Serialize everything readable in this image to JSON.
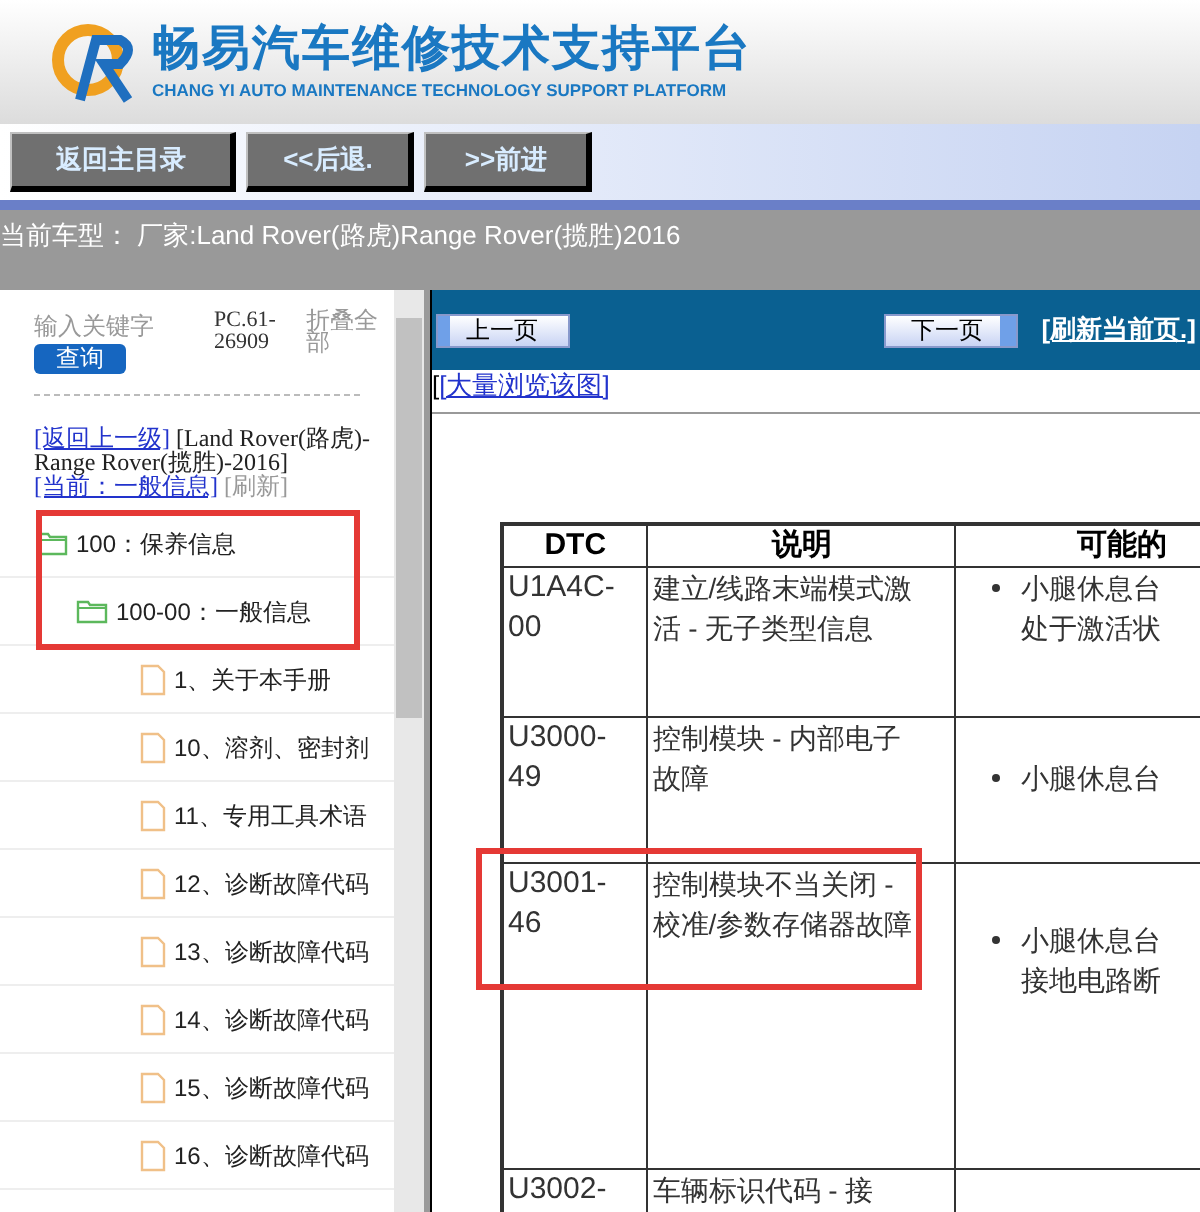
{
  "header": {
    "title": "畅易汽车维修技术支持平台",
    "subtitle": "CHANG YI AUTO MAINTENANCE TECHNOLOGY SUPPORT PLATFORM"
  },
  "nav_buttons": [
    "返回主目录",
    "<<后退.",
    ">>前进"
  ],
  "current_vehicle": "当前车型： 厂家:Land Rover(路虎)Range Rover(揽胜)2016",
  "sidebar": {
    "search": {
      "placeholder": "输入关键字",
      "button": "查询"
    },
    "code": "PC.61-26909",
    "collapse_all": "折叠全部",
    "back_link": "[返回上一级]",
    "vehicle_path": "[Land Rover(路虎)-Range Rover(揽胜)-2016]",
    "current_link": "[当前：一般信息]",
    "refresh": "[刷新]",
    "tree": [
      {
        "label": "100：保养信息",
        "expanded": true,
        "children": [
          {
            "label": "100-00：一般信息",
            "expanded": true,
            "children": [
              {
                "label": "1、关于本手册"
              },
              {
                "label": "10、溶剂、密封剂"
              },
              {
                "label": "11、专用工具术语"
              },
              {
                "label": "12、诊断故障代码"
              },
              {
                "label": "13、诊断故障代码"
              },
              {
                "label": "14、诊断故障代码"
              },
              {
                "label": "15、诊断故障代码"
              },
              {
                "label": "16、诊断故障代码"
              }
            ]
          }
        ]
      }
    ]
  },
  "toolbar": {
    "prev": "上一页",
    "next": "下一页",
    "refresh": "[刷新当前页.]"
  },
  "view_prefix": "[",
  "view_link": "[大量浏览该图]",
  "table": {
    "columns": [
      "DTC",
      "说明",
      "可能的"
    ],
    "rows": [
      {
        "cells": [
          "U1A4C-00",
          "建立/线路末端模式激活 - 无子类型信息",
          "小腿休息台处于激活状"
        ],
        "highlighted": false
      },
      {
        "cells": [
          "U3000-49",
          "控制模块 - 内部电子故障",
          "小腿休息台"
        ],
        "highlighted": false
      },
      {
        "cells": [
          "U3001-46",
          "控制模块不当关闭 - 校准/参数存储器故障",
          "小腿休息台接地电路断"
        ],
        "highlighted": true
      },
      {
        "cells": [
          "U3002-",
          "车辆标识代码 - 接"
        ],
        "highlighted": false
      }
    ]
  }
}
